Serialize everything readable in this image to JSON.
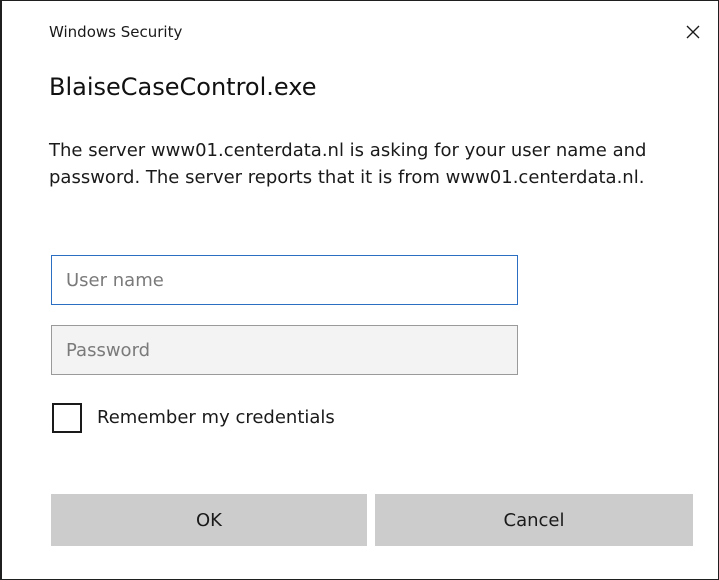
{
  "window": {
    "title": "Windows Security",
    "close_icon": "close-icon"
  },
  "app_name": "BlaiseCaseControl.exe",
  "message": "The server www01.centerdata.nl is asking for your user name and password. The server reports that it is from www01.centerdata.nl.",
  "form": {
    "username": {
      "value": "",
      "placeholder": "User name"
    },
    "password": {
      "value": "",
      "placeholder": "Password"
    },
    "remember": {
      "label": "Remember my credentials",
      "checked": false
    }
  },
  "buttons": {
    "ok_label": "OK",
    "cancel_label": "Cancel"
  },
  "colors": {
    "focus_border": "#2a6fc1",
    "button_bg": "#cccccc",
    "field_disabled_bg": "#f3f3f3"
  }
}
